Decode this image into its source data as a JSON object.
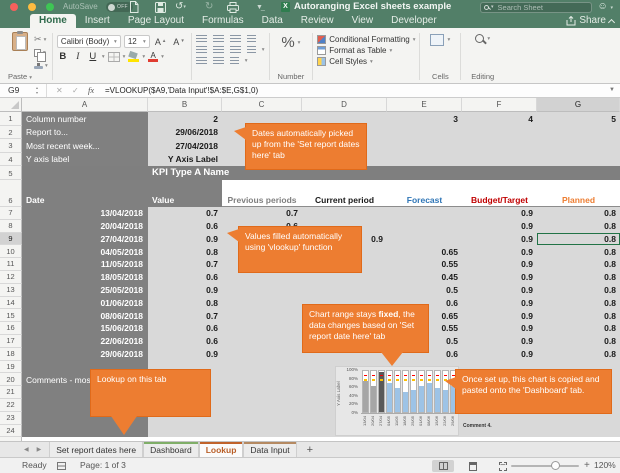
{
  "window": {
    "title": "Autoranging Excel sheets example",
    "autosave_label": "AutoSave",
    "autosave_state": "OFF",
    "search_placeholder": "Search Sheet"
  },
  "ribbon_tabs": {
    "items": [
      "Home",
      "Insert",
      "Page Layout",
      "Formulas",
      "Data",
      "Review",
      "View",
      "Developer"
    ],
    "active_index": 0,
    "share_label": "Share"
  },
  "ribbon": {
    "paste_label": "Paste",
    "font_name": "Calibri (Body)",
    "font_size": "12",
    "bold": "B",
    "italic": "I",
    "underline": "U",
    "number_label": "Number",
    "conditional_formatting": "Conditional Formatting",
    "format_as_table": "Format as Table",
    "cell_styles": "Cell Styles",
    "cells_label": "Cells",
    "editing_label": "Editing"
  },
  "formula_bar": {
    "cell_ref": "G9",
    "fx_label": "fx",
    "formula": "=VLOOKUP($A9,'Data Input'!$A:$E,G$1,0)"
  },
  "spreadsheet": {
    "columns": [
      "A",
      "B",
      "C",
      "D",
      "E",
      "F",
      "G"
    ],
    "selected": {
      "col": "G",
      "row": 9
    },
    "top_rows": [
      {
        "label": "Column number",
        "value": "2"
      },
      {
        "label": "Report to...",
        "value": "29/06/2018"
      },
      {
        "label": "Most recent week...",
        "value": "27/04/2018"
      },
      {
        "label": "Y axis label",
        "value": "Y Axis Label"
      }
    ],
    "col_numbers": {
      "E": "3",
      "F": "4",
      "G": "5"
    },
    "band_title": "KPI Type A Name",
    "header_row": {
      "A": "Date",
      "B": "Value",
      "C": "Previous periods",
      "D": "Current period",
      "E": "Forecast",
      "F": "Budget/Target",
      "G": "Planned"
    },
    "data_rows": [
      [
        "13/04/2018",
        "0.7",
        "0.7",
        "",
        "",
        "0.9",
        "0.8"
      ],
      [
        "20/04/2018",
        "0.6",
        "0.6",
        "",
        "",
        "0.9",
        "0.8"
      ],
      [
        "27/04/2018",
        "0.9",
        "",
        "0.9",
        "",
        "0.9",
        "0.8"
      ],
      [
        "04/05/2018",
        "0.8",
        "",
        "",
        "0.65",
        "0.9",
        "0.8"
      ],
      [
        "11/05/2018",
        "0.7",
        "",
        "",
        "0.55",
        "0.9",
        "0.8"
      ],
      [
        "18/05/2018",
        "0.6",
        "",
        "",
        "0.45",
        "0.9",
        "0.8"
      ],
      [
        "25/05/2018",
        "0.9",
        "",
        "",
        "0.5",
        "0.9",
        "0.8"
      ],
      [
        "01/06/2018",
        "0.8",
        "",
        "",
        "0.6",
        "0.9",
        "0.8"
      ],
      [
        "08/06/2018",
        "0.7",
        "",
        "",
        "0.65",
        "0.9",
        "0.8"
      ],
      [
        "15/06/2018",
        "0.6",
        "",
        "",
        "0.55",
        "0.9",
        "0.8"
      ],
      [
        "22/06/2018",
        "0.6",
        "",
        "",
        "0.5",
        "0.9",
        "0.8"
      ],
      [
        "29/06/2018",
        "0.9",
        "",
        "",
        "0.6",
        "0.9",
        "0.8"
      ]
    ],
    "comments_label": "Comments - most r",
    "comment_visible": "Comment 4."
  },
  "chart_data": {
    "type": "bar",
    "title": "",
    "ylabel": "Y Axis Label",
    "yticks": [
      "100%",
      "80%",
      "60%",
      "40%",
      "20%",
      "0%"
    ],
    "ylim": [
      0,
      1
    ],
    "x": [
      "13/04",
      "20/04",
      "27/04",
      "04/05",
      "11/05",
      "18/05",
      "25/05",
      "01/06",
      "08/06",
      "15/06",
      "22/06",
      "29/06"
    ],
    "bar_colors": [
      "#a6a6a6",
      "#a6a6a6",
      "#595959",
      "#9dc3e6",
      "#9dc3e6",
      "#9dc3e6",
      "#9dc3e6",
      "#9dc3e6",
      "#9dc3e6",
      "#9dc3e6",
      "#9dc3e6",
      "#9dc3e6"
    ],
    "series": [
      {
        "name": "Value",
        "values": [
          0.7,
          0.6,
          0.9,
          0.65,
          0.55,
          0.45,
          0.5,
          0.6,
          0.65,
          0.55,
          0.5,
          0.6
        ]
      },
      {
        "name": "Budget/Target",
        "values": [
          0.9,
          0.9,
          0.9,
          0.9,
          0.9,
          0.9,
          0.9,
          0.9,
          0.9,
          0.9,
          0.9,
          0.9
        ],
        "color": "#ff0000",
        "style": "dash"
      },
      {
        "name": "Planned",
        "values": [
          0.8,
          0.8,
          0.8,
          0.8,
          0.8,
          0.8,
          0.8,
          0.8,
          0.8,
          0.8,
          0.8,
          0.8
        ],
        "color": "#ffc000",
        "style": "dash"
      }
    ]
  },
  "callouts": [
    {
      "text": "Dates automatically picked up from the 'Set report dates here' tab"
    },
    {
      "text": "Values filled automatically using 'vlookup' function"
    },
    {
      "pre": "Chart range stays ",
      "bold": "fixed",
      "post": ", the data changes based on 'Set report date here' tab"
    },
    {
      "text": "Lookup on this tab"
    },
    {
      "text": "Once set up, this chart is copied and pasted onto the 'Dashboard' tab."
    }
  ],
  "sheet_tabs": {
    "tabs": [
      {
        "label": "Set report dates here",
        "accent": "",
        "active": false
      },
      {
        "label": "Dashboard",
        "accent": "#7fae68",
        "active": false
      },
      {
        "label": "Lookup",
        "accent": "#c0622a",
        "active": true
      },
      {
        "label": "Data Input",
        "accent": "#b58a62",
        "active": false
      }
    ],
    "add_label": "+"
  },
  "status_bar": {
    "ready": "Ready",
    "page": "Page: 1 of 3",
    "zoom": "120%"
  }
}
